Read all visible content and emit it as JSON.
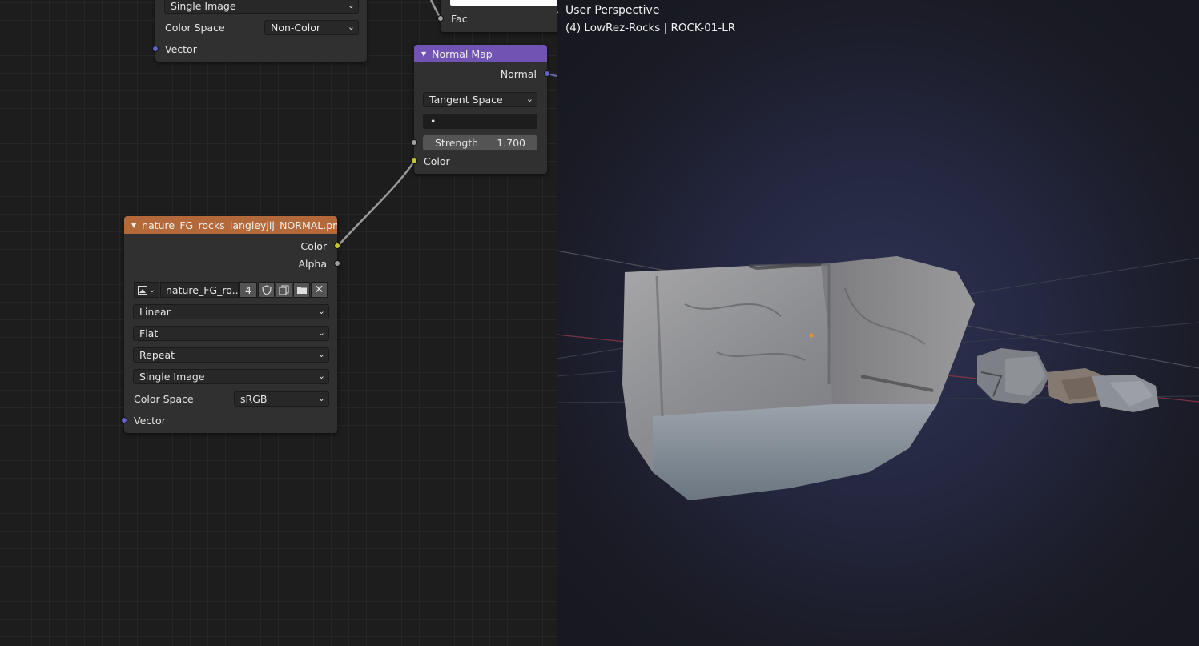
{
  "node_editor": {
    "top_image_node": {
      "source_value": "Single Image",
      "color_space_label": "Color Space",
      "color_space_value": "Non-Color",
      "vector_label": "Vector"
    },
    "mix_node": {
      "fac_label": "Fac"
    },
    "normal_map_node": {
      "title": "Normal Map",
      "output_label": "Normal",
      "space_value": "Tangent Space",
      "uv_map_value": "•",
      "strength_label": "Strength",
      "strength_value": "1.700",
      "color_input_label": "Color"
    },
    "image_texture_node": {
      "title": "nature_FG_rocks_langleyjij_NORMAL.pn...",
      "color_output_label": "Color",
      "alpha_output_label": "Alpha",
      "image_name": "nature_FG_ro...",
      "user_count": "4",
      "interpolation_value": "Linear",
      "projection_value": "Flat",
      "extension_value": "Repeat",
      "source_value": "Single Image",
      "color_space_label": "Color Space",
      "color_space_value": "sRGB",
      "vector_label": "Vector"
    }
  },
  "viewport": {
    "view_label": "User Perspective",
    "object_label": "(4) LowRez-Rocks | ROCK-01-LR"
  },
  "colors": {
    "image_header": "#b3693a",
    "normal_map_header": "#7153b3",
    "color_socket": "#c7c729",
    "vector_socket": "#6363c7",
    "grey_socket": "#a1a1a1",
    "origin_dot": "#f0902a"
  },
  "icons": {
    "collapse": "triangle-down-icon",
    "dropdown": "chevron-down-icon",
    "image_browse": "image-icon",
    "fake_user": "shield-icon",
    "duplicate": "copy-icon",
    "open": "folder-icon",
    "unlink": "close-icon"
  }
}
